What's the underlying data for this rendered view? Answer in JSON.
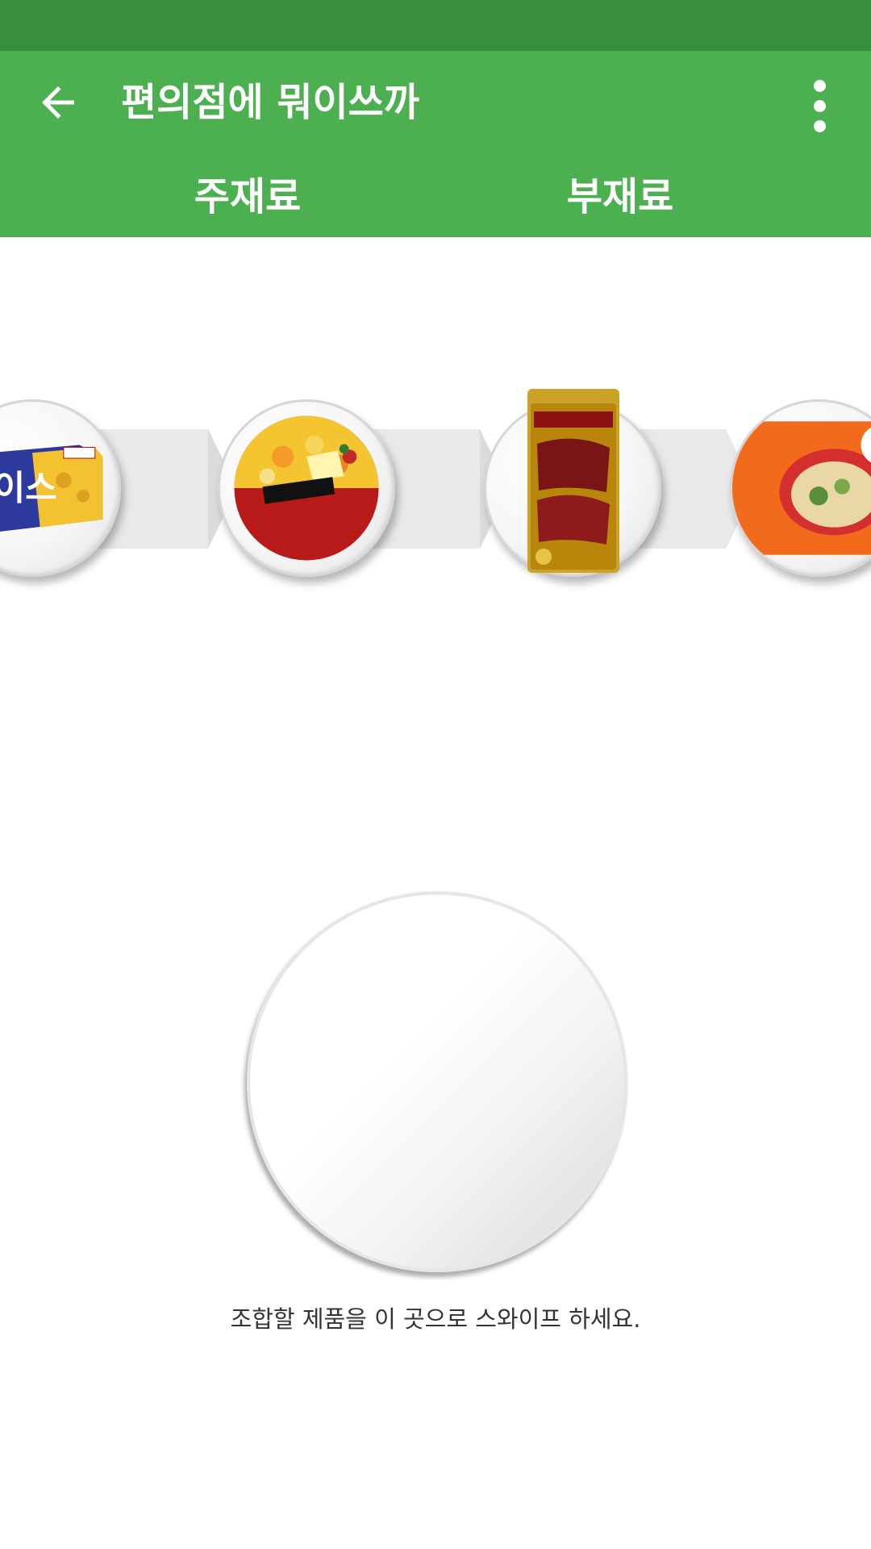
{
  "app_bar": {
    "title": "편의점에 뭐이쓰까",
    "back_icon": "arrow-back-icon",
    "menu_icon": "more-vert-icon",
    "background_color": "#4caf50",
    "status_bar_color": "#388e3c"
  },
  "tabs": [
    {
      "label": "주재료",
      "selected": true
    },
    {
      "label": "부재료",
      "selected": false
    }
  ],
  "carousel": {
    "items": [
      {
        "product": "cracker-box",
        "package_text": "에이스"
      },
      {
        "product": "fried-noodle-bowl"
      },
      {
        "product": "beef-jerky-pack"
      },
      {
        "product": "ramen-pack"
      }
    ]
  },
  "drop_zone": {
    "instruction": "조합할 제품을 이 곳으로 스와이프 하세요."
  }
}
